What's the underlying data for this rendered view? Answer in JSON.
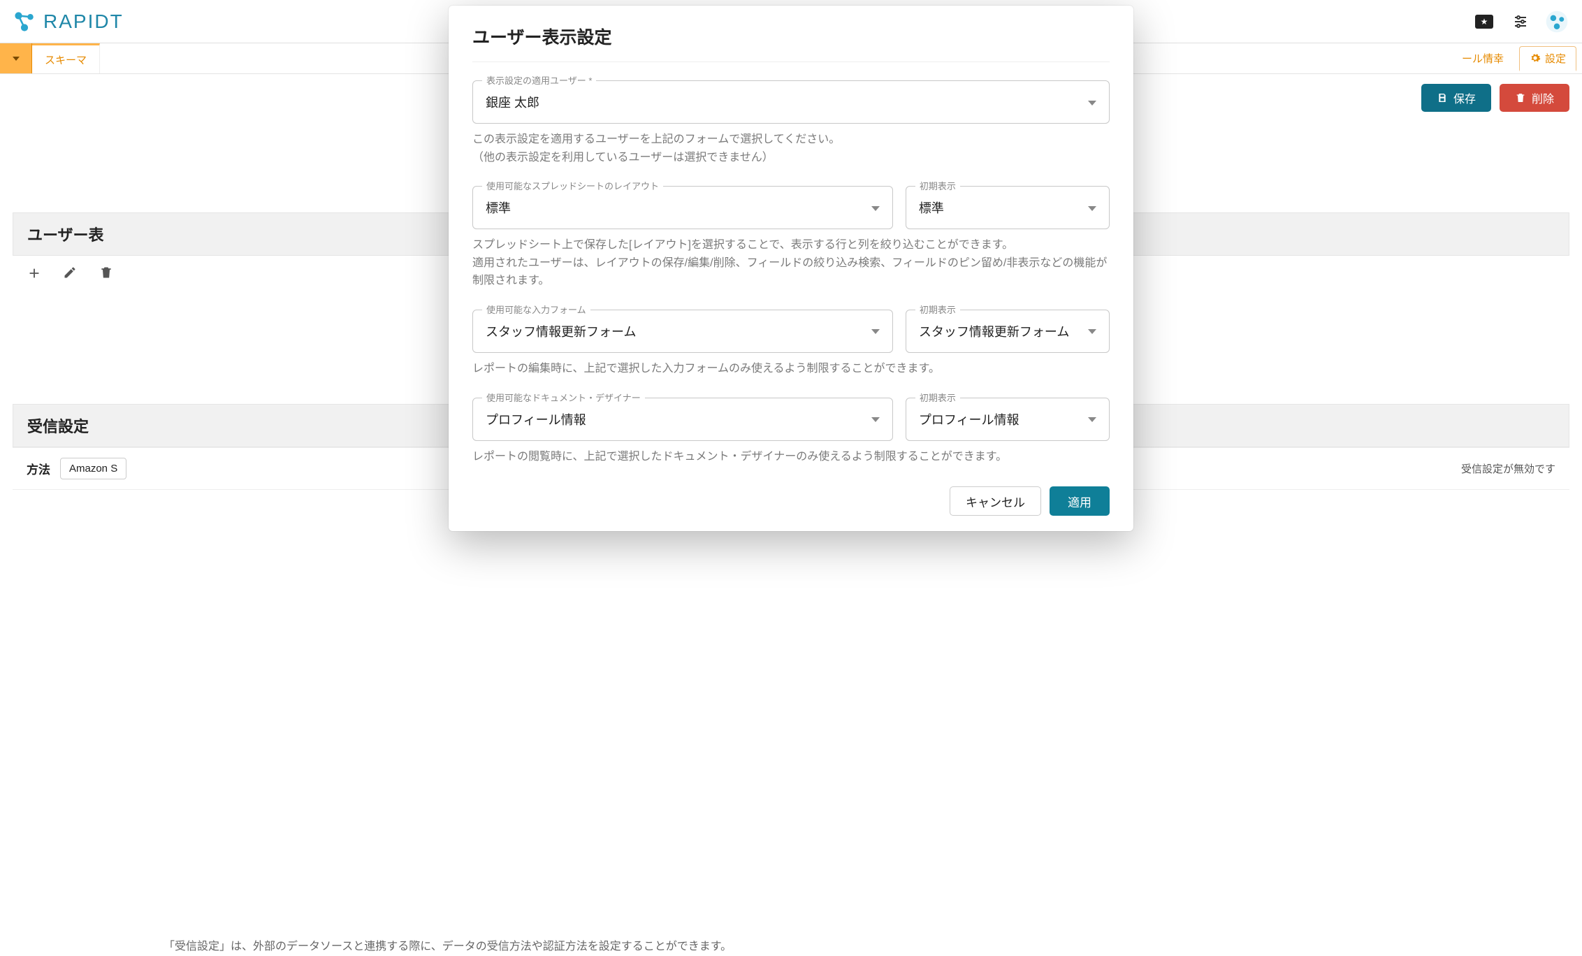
{
  "topbar": {
    "brand": "RAPIDT"
  },
  "toolbar": {
    "schema_tab": "スキーマ",
    "right_chip": "ール情幸",
    "settings_tab": "設定"
  },
  "actions": {
    "save": "保存",
    "delete": "削除"
  },
  "bg_sections": {
    "user_display_heading": "ユーザー表",
    "receive_heading": "受信設定",
    "method_label": "方法",
    "method_value": "Amazon S",
    "receive_status": "受信設定が無効です"
  },
  "bottom_note": "「受信設定」は、外部のデータソースと連携する際に、データの受信方法や認証方法を設定することができます。",
  "modal": {
    "title": "ユーザー表示設定",
    "user_field": {
      "legend": "表示設定の適用ユーザー *",
      "value": "銀座 太郎",
      "help1": "この表示設定を適用するユーザーを上記のフォームで選択してください。",
      "help2": "（他の表示設定を利用しているユーザーは選択できません）"
    },
    "layout_field": {
      "legend_main": "使用可能なスプレッドシートのレイアウト",
      "value_main": "標準",
      "legend_default": "初期表示",
      "value_default": "標準",
      "help1": "スプレッドシート上で保存した[レイアウト]を選択することで、表示する行と列を絞り込むことができます。",
      "help2": "適用されたユーザーは、レイアウトの保存/編集/削除、フィールドの絞り込み検索、フィールドのピン留め/非表示などの機能が制限されます。"
    },
    "form_field": {
      "legend_main": "使用可能な入力フォーム",
      "value_main": "スタッフ情報更新フォーム",
      "legend_default": "初期表示",
      "value_default": "スタッフ情報更新フォーム",
      "help": "レポートの編集時に、上記で選択した入力フォームのみ使えるよう制限することができます。"
    },
    "doc_field": {
      "legend_main": "使用可能なドキュメント・デザイナー",
      "value_main": "プロフィール情報",
      "legend_default": "初期表示",
      "value_default": "プロフィール情報",
      "help": "レポートの閲覧時に、上記で選択したドキュメント・デザイナーのみ使えるよう制限することができます。"
    },
    "buttons": {
      "cancel": "キャンセル",
      "apply": "適用"
    }
  }
}
